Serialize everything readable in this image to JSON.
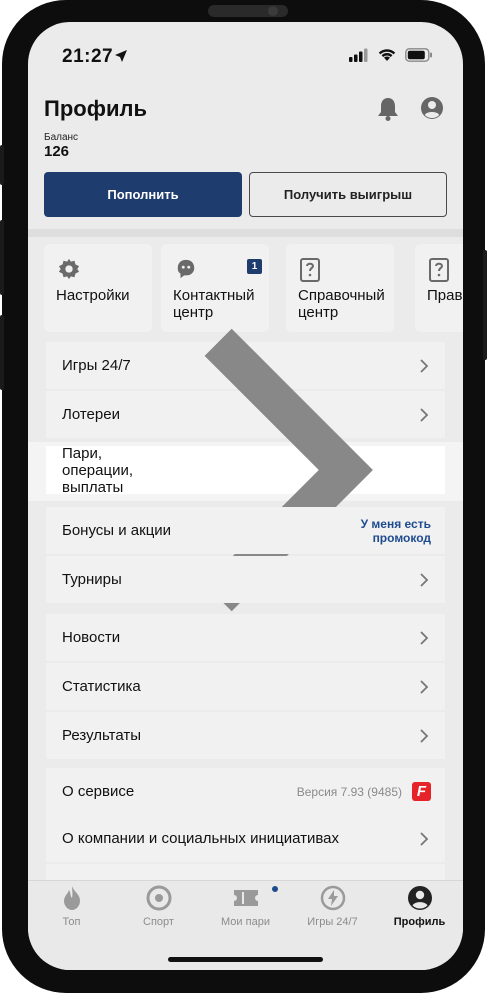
{
  "status": {
    "time": "21:27"
  },
  "header": {
    "title": "Профиль",
    "balance_label": "Баланс",
    "balance_value": "126"
  },
  "actions": {
    "deposit": "Пополнить",
    "withdraw": "Получить выигрыш"
  },
  "tiles": [
    {
      "line1": "Настройки",
      "line2": "",
      "icon": "gear-icon"
    },
    {
      "line1": "Контактный",
      "line2": "центр",
      "icon": "support-icon",
      "badge": "1"
    },
    {
      "line1": "Справочный",
      "line2": "центр",
      "icon": "question-doc-icon"
    },
    {
      "line1": "Прав",
      "line2": "",
      "icon": "question-doc-icon"
    }
  ],
  "menu": {
    "games": "Игры 24/7",
    "lotteries": "Лотереи",
    "bets": "Пари, операции, выплаты",
    "bonuses": "Бонусы и акции",
    "promo_line1": "У меня есть",
    "promo_line2": "промокод",
    "tournaments": "Турниры",
    "news": "Новости",
    "statistics": "Статистика",
    "results": "Результаты",
    "about": "О сервисе",
    "version": "Версия 7.93 (9485)",
    "company": "О компании и социальных инициативах"
  },
  "tabs": [
    {
      "label": "Топ",
      "icon": "flame-icon"
    },
    {
      "label": "Спорт",
      "icon": "target-icon"
    },
    {
      "label": "Мои пари",
      "icon": "ticket-icon"
    },
    {
      "label": "Игры 24/7",
      "icon": "bolt-icon"
    },
    {
      "label": "Профиль",
      "icon": "profile-icon"
    }
  ],
  "colors": {
    "primary": "#1e3c6e",
    "accent_link": "#1e4b8e",
    "brand": "#e52328"
  }
}
